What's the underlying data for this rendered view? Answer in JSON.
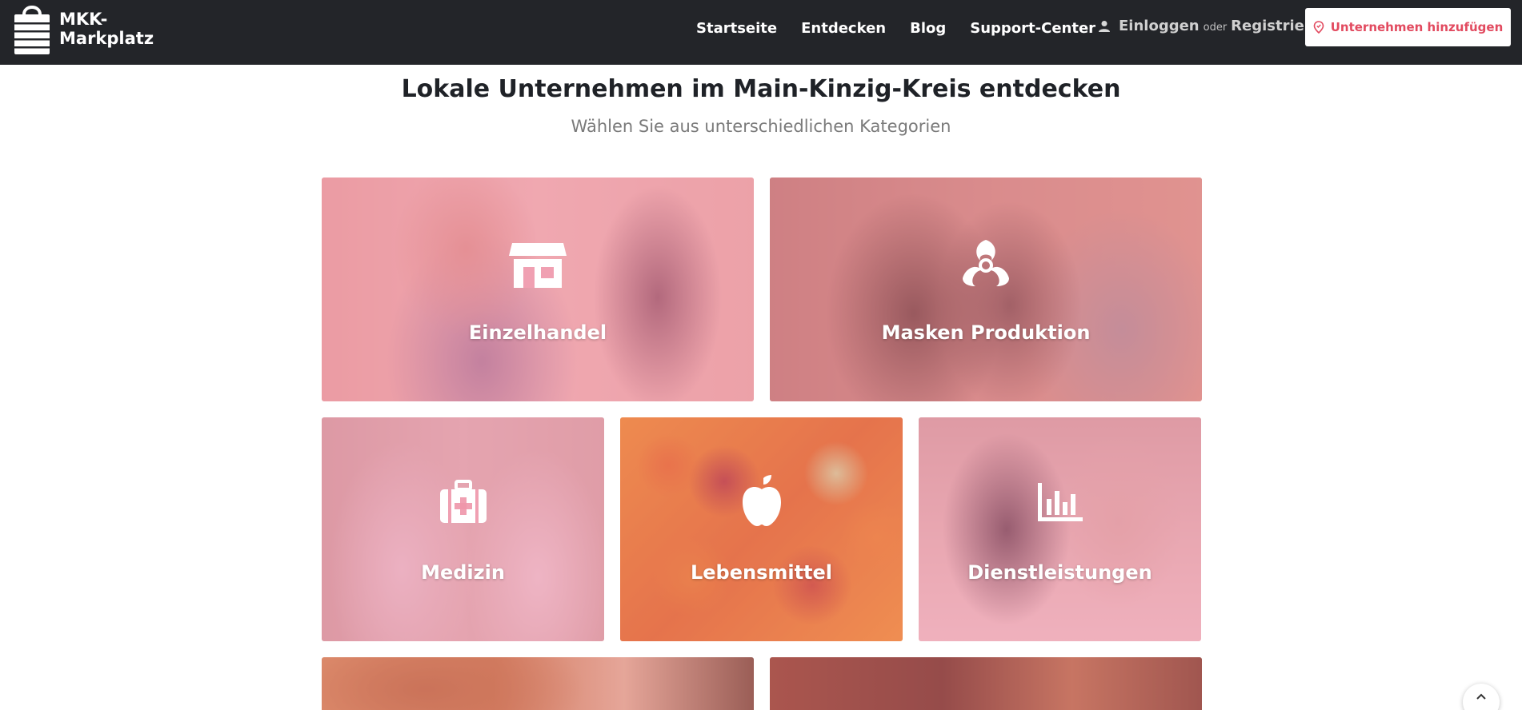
{
  "brand": {
    "line1": "MKK-",
    "line2": "Markplatz"
  },
  "nav": {
    "items": [
      "Startseite",
      "Entdecken",
      "Blog",
      "Support-Center"
    ]
  },
  "auth": {
    "login": "Einloggen",
    "or": "oder",
    "register": "Registrieren"
  },
  "cta": {
    "label": "Unternehmen hinzufügen"
  },
  "hero": {
    "title": "Lokale Unternehmen im Main-Kinzig-Kreis entdecken",
    "subtitle": "Wählen Sie aus unterschiedlichen Kategorien"
  },
  "categories": [
    {
      "label": "Einzelhandel",
      "icon": "store-icon"
    },
    {
      "label": "Masken Produktion",
      "icon": "biohazard-icon"
    },
    {
      "label": "Medizin",
      "icon": "medkit-icon"
    },
    {
      "label": "Lebensmittel",
      "icon": "apple-icon"
    },
    {
      "label": "Dienstleistungen",
      "icon": "bar-chart-icon"
    }
  ],
  "colors": {
    "header": "#232529",
    "accent": "#e24a5f",
    "overlay": "#f08aa0"
  }
}
